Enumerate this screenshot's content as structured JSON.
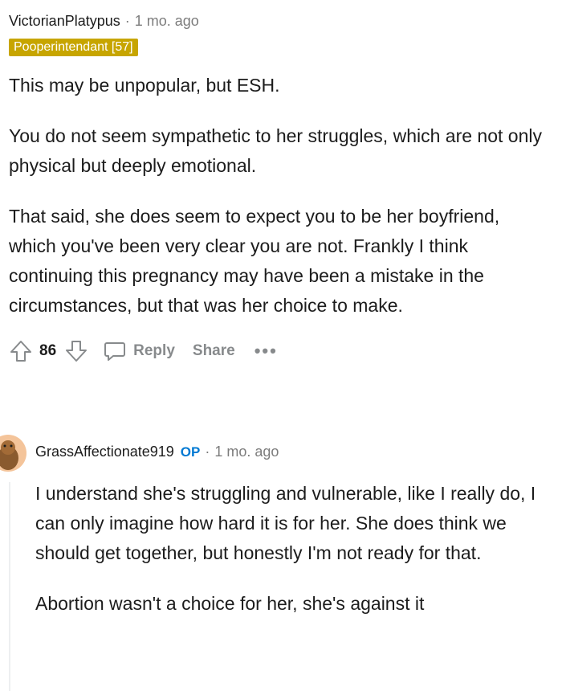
{
  "comment1": {
    "author": "VictorianPlatypus",
    "separator": "·",
    "time": "1 mo. ago",
    "flair": "Pooperintendant [57]",
    "paragraphs": [
      "This may be unpopular, but ESH.",
      "You do not seem sympathetic to her struggles, which are not only physical but deeply emotional.",
      "That said, she does seem to expect you to be her boyfriend, which you've been very clear you are not. Frankly I think continuing this pregnancy may have been a mistake in the circumstances, but that was her choice to make."
    ],
    "actions": {
      "votes": "86",
      "reply_label": "Reply",
      "share_label": "Share",
      "more_label": "•••"
    }
  },
  "comment2": {
    "author": "GrassAffectionate919",
    "op_badge": "OP",
    "separator": "·",
    "time": "1 mo. ago",
    "paragraphs": [
      "I understand she's struggling and vulnerable, like I really do, I can only imagine how hard it is for her. She does think we should get together, but honestly I'm not ready for that.",
      "Abortion wasn't a choice for her, she's against it"
    ]
  },
  "colors": {
    "flair_bg": "#c7a500",
    "op_blue": "#0079d3",
    "muted": "#878a8c"
  }
}
